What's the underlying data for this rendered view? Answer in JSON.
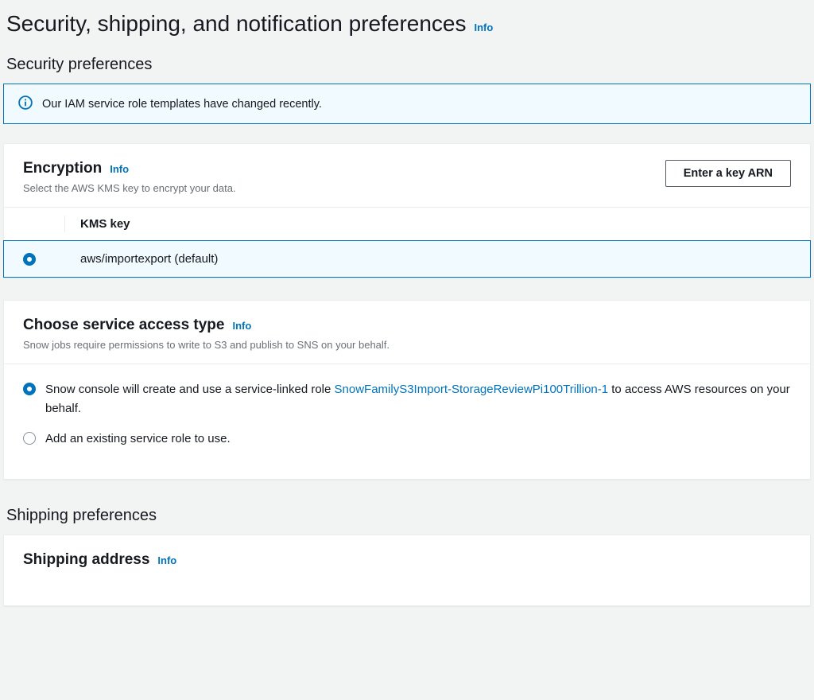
{
  "page": {
    "title": "Security, shipping, and notification preferences",
    "info_label": "Info"
  },
  "security_section": {
    "heading": "Security preferences",
    "alert": {
      "text": "Our IAM service role templates have changed recently."
    },
    "encryption_panel": {
      "title": "Encryption",
      "info_label": "Info",
      "desc": "Select the AWS KMS key to encrypt your data.",
      "button_label": "Enter a key ARN",
      "table": {
        "header": "KMS key",
        "rows": [
          {
            "label": "aws/importexport (default)",
            "selected": true
          }
        ]
      }
    },
    "service_access_panel": {
      "title": "Choose service access type",
      "info_label": "Info",
      "desc": "Snow jobs require permissions to write to S3 and publish to SNS on your behalf.",
      "options": {
        "create_role": {
          "text_before": "Snow console will create and use a service-linked role ",
          "role_link": "SnowFamilyS3Import-StorageReviewPi100Trillion-1",
          "text_after": " to access AWS resources on your behalf.",
          "selected": true
        },
        "existing_role": {
          "label": "Add an existing service role to use.",
          "selected": false
        }
      }
    }
  },
  "shipping_section": {
    "heading": "Shipping preferences",
    "address_panel": {
      "title": "Shipping address",
      "info_label": "Info"
    }
  }
}
